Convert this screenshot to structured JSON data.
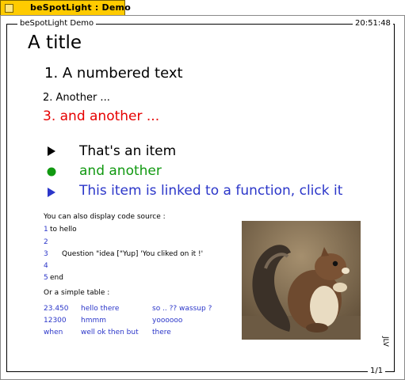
{
  "window": {
    "tab_title": "beSpotLight : Demo"
  },
  "frame": {
    "app_label": "beSpotLight Demo",
    "clock": "20:51:48",
    "page": "1/1",
    "side_label": "JLV"
  },
  "slide": {
    "title": "A title",
    "numbered": [
      "1. A numbered text",
      "2. Another ...",
      "3. and another ..."
    ],
    "items": [
      {
        "text": "That's an item",
        "bullet": "triangle",
        "color": "#000000"
      },
      {
        "text": "and another",
        "bullet": "circle",
        "color": "#119911"
      },
      {
        "text": "This item is linked to a function, click it",
        "bullet": "triangle",
        "color": "#2b36c9"
      }
    ],
    "code_intro": "You can also display code source :",
    "code_lines": [
      {
        "num": "1",
        "text": "to hello"
      },
      {
        "num": "2",
        "text": ""
      },
      {
        "num": "3",
        "text": "Question \"idea [\"Yup] 'You cliked on it !'"
      },
      {
        "num": "4",
        "text": ""
      },
      {
        "num": "5",
        "text": "end"
      }
    ],
    "table_intro": "Or a simple table :",
    "table": [
      [
        "23.450",
        "hello there",
        "so .. ?? wassup ?"
      ],
      [
        "12300",
        "hmmm",
        "yoooooo"
      ],
      [
        "when",
        "well ok then but",
        "there"
      ]
    ],
    "image": "squirrel-photo"
  }
}
